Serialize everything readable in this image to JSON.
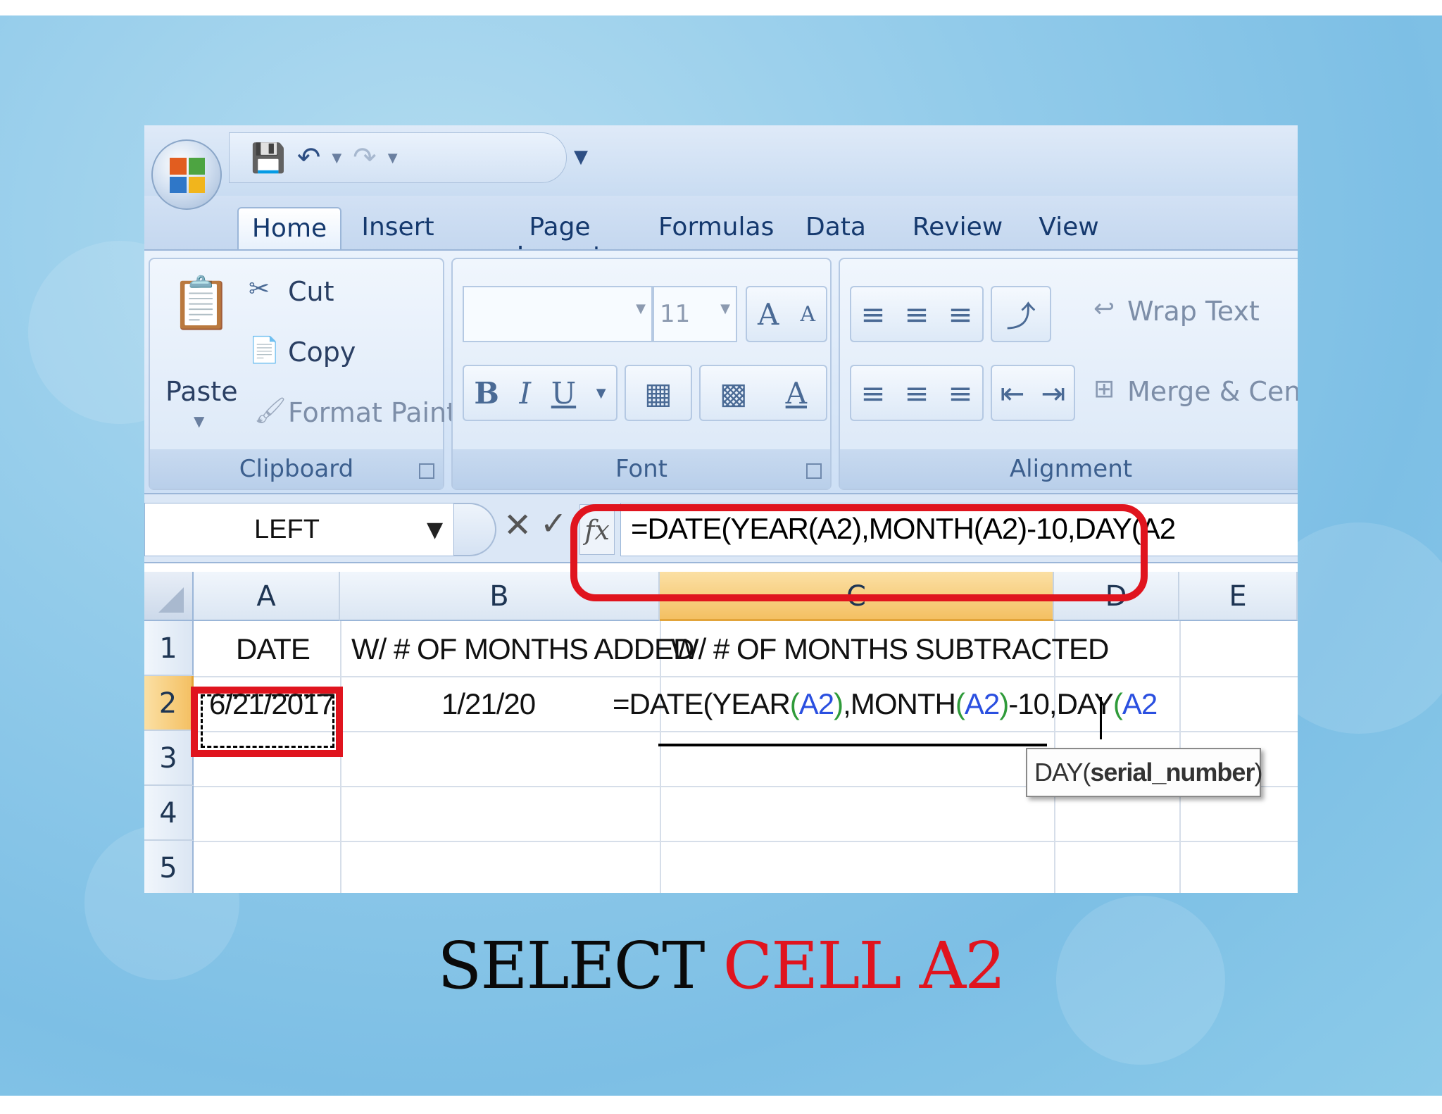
{
  "qat": {
    "save_icon": "save-icon",
    "undo_icon": "undo-icon",
    "redo_icon": "redo-icon",
    "more_icon": "customize-icon"
  },
  "tabs": [
    {
      "label": "Home",
      "active": true
    },
    {
      "label": "Insert"
    },
    {
      "label": "Page Layout"
    },
    {
      "label": "Formulas"
    },
    {
      "label": "Data"
    },
    {
      "label": "Review"
    },
    {
      "label": "View"
    }
  ],
  "ribbon": {
    "clipboard": {
      "label": "Clipboard",
      "paste": "Paste",
      "cut": "Cut",
      "copy": "Copy",
      "format_painter": "Format Painter"
    },
    "font": {
      "label": "Font",
      "font_name": "",
      "font_size": "11",
      "bold": "B",
      "italic": "I",
      "underline": "U",
      "grow": "A",
      "shrink": "A",
      "font_color": "A"
    },
    "alignment": {
      "label": "Alignment",
      "wrap_text": "Wrap Text",
      "merge_center": "Merge & Center"
    }
  },
  "formula_bar": {
    "name_box": "LEFT",
    "fx": "fx",
    "cancel": "✕",
    "enter": "✓",
    "formula": "=DATE(YEAR(A2),MONTH(A2)-10,DAY(A2"
  },
  "sheet": {
    "columns": [
      "A",
      "B",
      "C",
      "D",
      "E"
    ],
    "rows": [
      "1",
      "2",
      "3",
      "4",
      "5"
    ],
    "cells": {
      "A1": "DATE",
      "B1": "W/ # OF MONTHS ADDED",
      "C1": "W/ # OF MONTHS SUBTRACTED",
      "A2": "6/21/2017",
      "B2": "1/21/20"
    },
    "c2_formula_parts": [
      "=DATE(YEAR",
      "(",
      "A2",
      ")",
      ",MONTH",
      "(",
      "A2",
      ")",
      "-10,DAY",
      "(",
      "A2"
    ],
    "tooltip": {
      "func": "DAY(",
      "arg": "serial_number",
      "close": ")"
    }
  },
  "caption": {
    "black": "SELECT ",
    "red": "CELL A2"
  },
  "colors": {
    "highlight": "#e0141e",
    "ref_blue": "#2a4fe0",
    "ref_green": "#2f9b3a",
    "selected_header": "#f4c063"
  }
}
